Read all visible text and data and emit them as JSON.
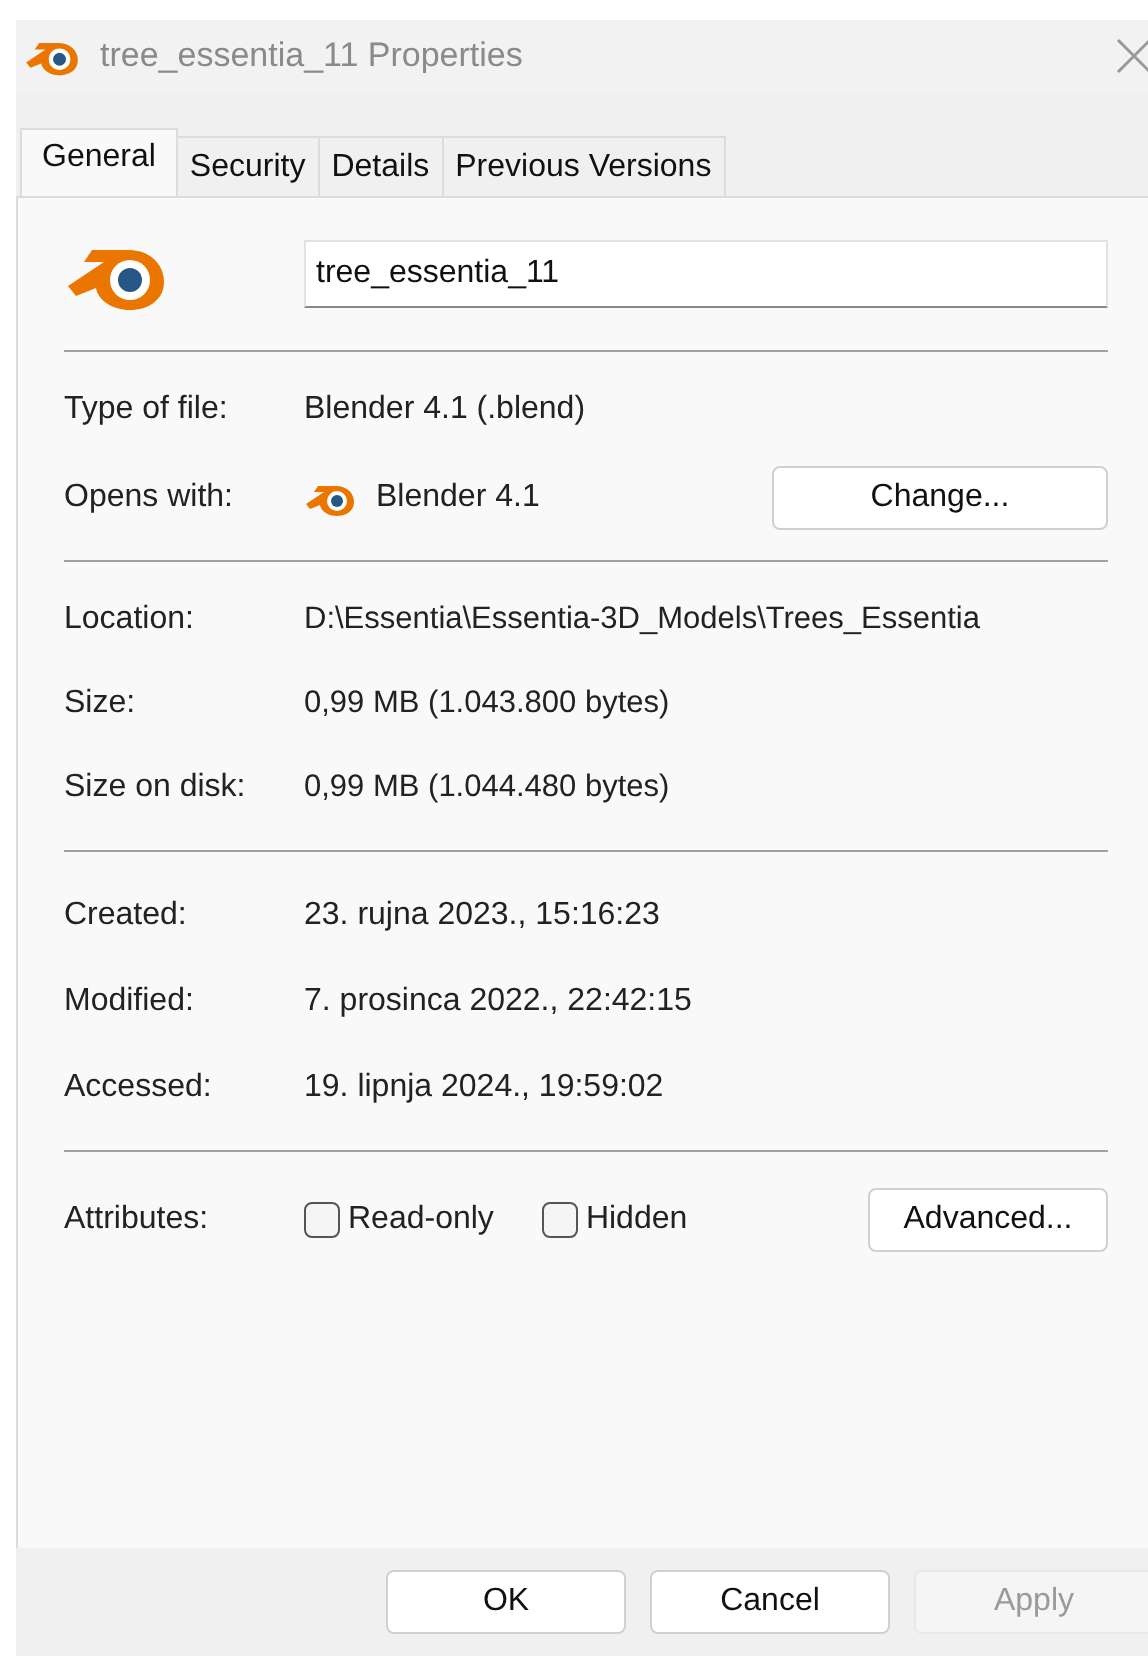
{
  "window": {
    "title": "tree_essentia_11 Properties"
  },
  "tabs": [
    {
      "label": "General",
      "selected": true
    },
    {
      "label": "Security",
      "selected": false
    },
    {
      "label": "Details",
      "selected": false
    },
    {
      "label": "Previous Versions",
      "selected": false
    }
  ],
  "file_name": {
    "value": "tree_essentia_11"
  },
  "type_section": [
    {
      "kind": "text",
      "label": "Type of file:",
      "value": "Blender 4.1 (.blend)"
    },
    {
      "kind": "app",
      "label": "Opens with:",
      "value": "Blender 4.1",
      "button": "Change..."
    }
  ],
  "location_section": [
    {
      "label": "Location:",
      "value": "D:\\Essentia\\Essentia-3D_Models\\Trees_Essentia"
    },
    {
      "label": "Size:",
      "value": "0,99 MB (1.043.800 bytes)"
    },
    {
      "label": "Size on disk:",
      "value": "0,99 MB (1.044.480 bytes)"
    }
  ],
  "dates_section": [
    {
      "label": "Created:",
      "value": "23. rujna 2023., 15:16:23"
    },
    {
      "label": "Modified:",
      "value": "7. prosinca 2022., 22:42:15"
    },
    {
      "label": "Accessed:",
      "value": "19. lipnja 2024., 19:59:02"
    }
  ],
  "attributes": {
    "label": "Attributes:",
    "checkboxes": [
      {
        "label": "Read-only",
        "checked": false
      },
      {
        "label": "Hidden",
        "checked": false
      }
    ],
    "button": "Advanced..."
  },
  "buttons": [
    {
      "label": "OK",
      "disabled": false
    },
    {
      "label": "Cancel",
      "disabled": false
    },
    {
      "label": "Apply",
      "disabled": true
    }
  ]
}
